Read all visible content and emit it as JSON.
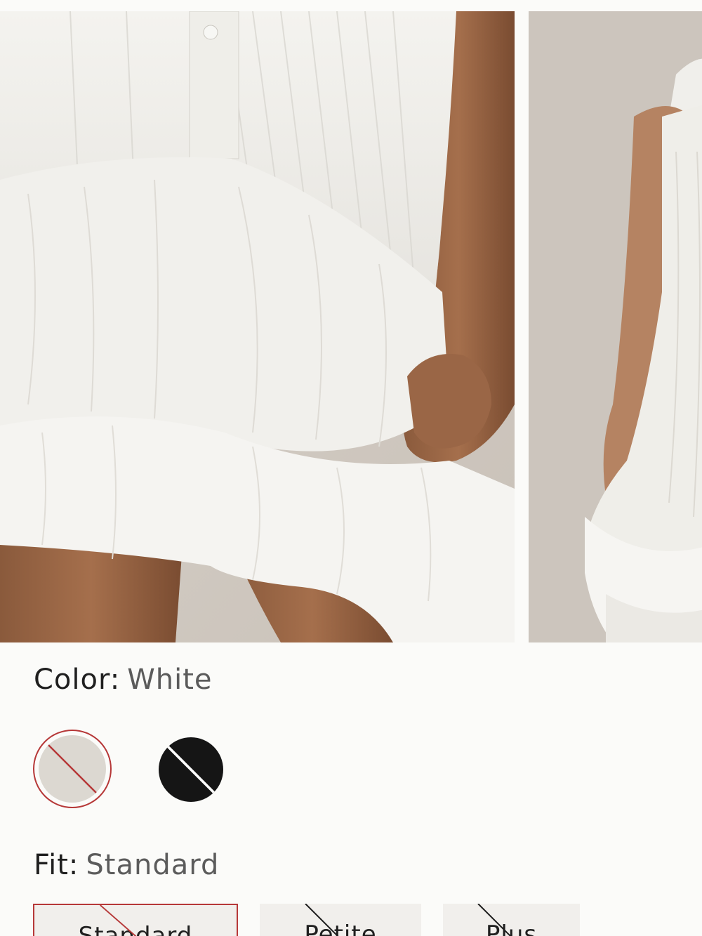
{
  "carousel": {
    "images": [
      {
        "alt_icon": "product-photo-dress-detail"
      },
      {
        "alt_icon": "product-photo-dress-side"
      }
    ]
  },
  "color": {
    "label": "Color:",
    "selected": "White",
    "swatches": [
      {
        "name": "White",
        "color": "#dcd8d1",
        "unavailable": true,
        "selected": true
      },
      {
        "name": "Black",
        "color": "#151515",
        "unavailable": true,
        "selected": false
      }
    ]
  },
  "fit": {
    "label": "Fit:",
    "selected": "Standard",
    "options": [
      {
        "label": "Standard",
        "unavailable": true,
        "selected": true
      },
      {
        "label": "Petite",
        "unavailable": true,
        "selected": false
      },
      {
        "label": "Plus",
        "unavailable": true,
        "selected": false
      }
    ]
  },
  "colors": {
    "accent": "#b63838",
    "background": "#fbfbf9",
    "button_bg": "#f1efec"
  }
}
